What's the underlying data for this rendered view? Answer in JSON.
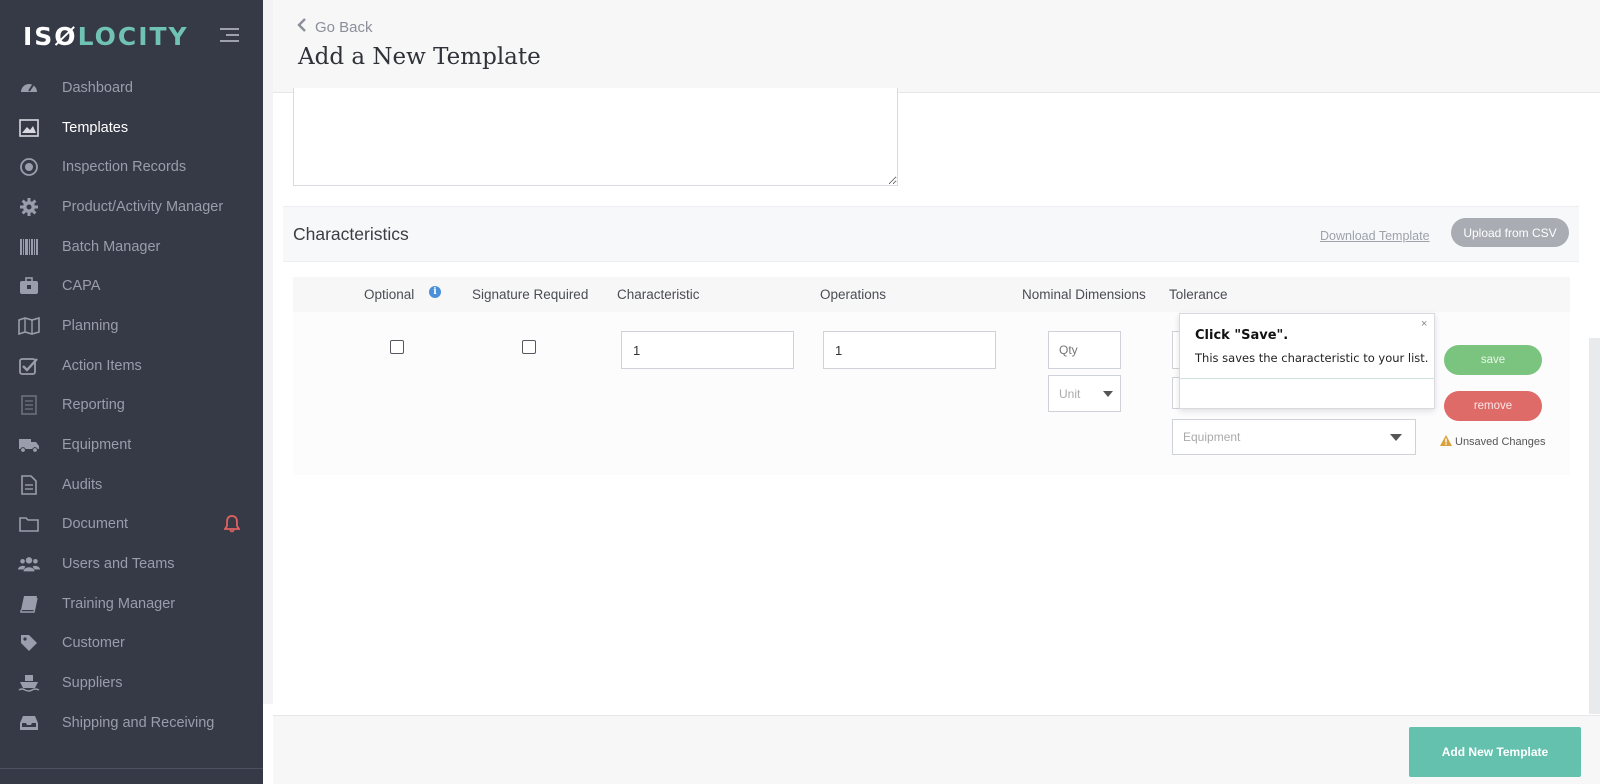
{
  "app": {
    "logo_prefix": "ISØ",
    "logo_suffix": "LOCITY"
  },
  "sidebar": {
    "items": [
      {
        "label": "Dashboard",
        "icon": "dashboard-icon",
        "active": false
      },
      {
        "label": "Templates",
        "icon": "image-icon",
        "active": true
      },
      {
        "label": "Inspection Records",
        "icon": "target-icon",
        "active": false
      },
      {
        "label": "Product/Activity Manager",
        "icon": "gear-icon",
        "active": false
      },
      {
        "label": "Batch Manager",
        "icon": "barcode-icon",
        "active": false
      },
      {
        "label": "CAPA",
        "icon": "briefcase-icon",
        "active": false
      },
      {
        "label": "Planning",
        "icon": "map-icon",
        "active": false
      },
      {
        "label": "Action Items",
        "icon": "checkbox-icon",
        "active": false
      },
      {
        "label": "Reporting",
        "icon": "report-icon",
        "active": false
      },
      {
        "label": "Equipment",
        "icon": "truck-icon",
        "active": false
      },
      {
        "label": "Audits",
        "icon": "file-icon",
        "active": false
      },
      {
        "label": "Document",
        "icon": "folder-icon",
        "active": false
      },
      {
        "label": "Users and Teams",
        "icon": "users-icon",
        "active": false
      },
      {
        "label": "Training Manager",
        "icon": "book-icon",
        "active": false
      },
      {
        "label": "Customer",
        "icon": "tag-icon",
        "active": false
      },
      {
        "label": "Suppliers",
        "icon": "ship-icon",
        "active": false
      },
      {
        "label": "Shipping and Receiving",
        "icon": "inbox-icon",
        "active": false
      }
    ]
  },
  "header": {
    "go_back": "Go Back",
    "title": "Add a New Template"
  },
  "characteristics": {
    "title": "Characteristics",
    "download_link": "Download Template",
    "upload_button": "Upload from CSV",
    "columns": {
      "optional": "Optional",
      "signature_required": "Signature Required",
      "characteristic": "Characteristic",
      "operations": "Operations",
      "nominal_dimensions": "Nominal Dimensions",
      "tolerance": "Tolerance"
    },
    "row": {
      "characteristic_value": "1",
      "operations_value": "1",
      "qty_placeholder": "Qty",
      "unit_placeholder": "Unit",
      "equipment_placeholder": "Equipment",
      "save_label": "save",
      "remove_label": "remove",
      "unsaved_label": "Unsaved Changes"
    }
  },
  "tooltip": {
    "title": "Click \"Save\".",
    "body": "This saves the characteristic to your list.",
    "close": "×"
  },
  "footer": {
    "add_button": "Add New Template"
  },
  "colors": {
    "sidebar_bg": "#363946",
    "accent": "#6fc2b4",
    "save": "#7bc47f",
    "remove": "#df6b69",
    "warning": "#d9a13b"
  }
}
